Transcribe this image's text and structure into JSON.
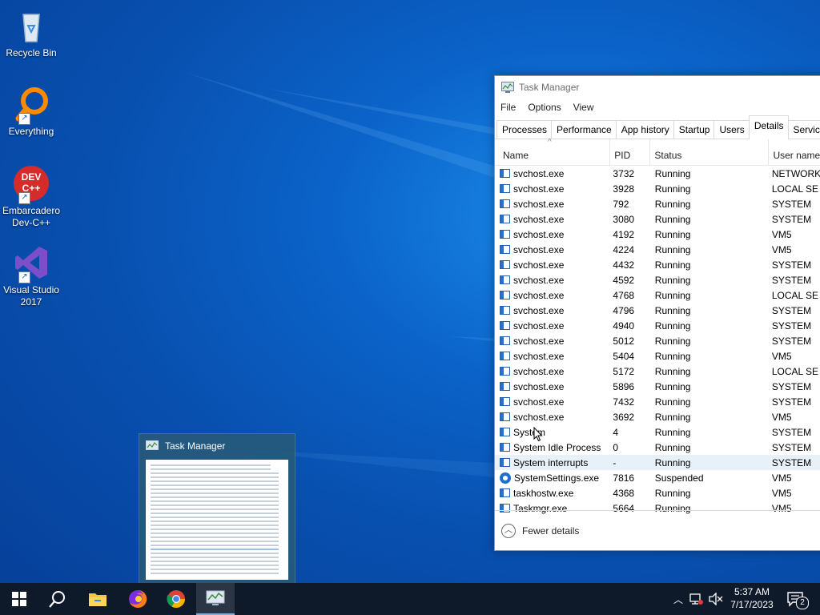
{
  "desktop": {
    "icons": [
      {
        "label": "Recycle Bin",
        "icon": "recycle-bin-icon"
      },
      {
        "label": "Everything",
        "icon": "everything-search-icon"
      },
      {
        "label": "Embarcadero Dev-C++",
        "icon": "dev-cpp-icon",
        "badge_text": "DEV C++"
      },
      {
        "label": "Visual Studio 2017",
        "icon": "visual-studio-icon"
      }
    ]
  },
  "task_manager": {
    "title": "Task Manager",
    "menu": [
      "File",
      "Options",
      "View"
    ],
    "tabs": [
      "Processes",
      "Performance",
      "App history",
      "Startup",
      "Users",
      "Details",
      "Services"
    ],
    "active_tab": "Details",
    "columns": [
      "Name",
      "PID",
      "Status",
      "User name"
    ],
    "rows": [
      {
        "name": "svchost.exe",
        "pid": "3732",
        "status": "Running",
        "user": "NETWORK"
      },
      {
        "name": "svchost.exe",
        "pid": "3928",
        "status": "Running",
        "user": "LOCAL SE"
      },
      {
        "name": "svchost.exe",
        "pid": "792",
        "status": "Running",
        "user": "SYSTEM"
      },
      {
        "name": "svchost.exe",
        "pid": "3080",
        "status": "Running",
        "user": "SYSTEM"
      },
      {
        "name": "svchost.exe",
        "pid": "4192",
        "status": "Running",
        "user": "VM5"
      },
      {
        "name": "svchost.exe",
        "pid": "4224",
        "status": "Running",
        "user": "VM5"
      },
      {
        "name": "svchost.exe",
        "pid": "4432",
        "status": "Running",
        "user": "SYSTEM"
      },
      {
        "name": "svchost.exe",
        "pid": "4592",
        "status": "Running",
        "user": "SYSTEM"
      },
      {
        "name": "svchost.exe",
        "pid": "4768",
        "status": "Running",
        "user": "LOCAL SE"
      },
      {
        "name": "svchost.exe",
        "pid": "4796",
        "status": "Running",
        "user": "SYSTEM"
      },
      {
        "name": "svchost.exe",
        "pid": "4940",
        "status": "Running",
        "user": "SYSTEM"
      },
      {
        "name": "svchost.exe",
        "pid": "5012",
        "status": "Running",
        "user": "SYSTEM"
      },
      {
        "name": "svchost.exe",
        "pid": "5404",
        "status": "Running",
        "user": "VM5"
      },
      {
        "name": "svchost.exe",
        "pid": "5172",
        "status": "Running",
        "user": "LOCAL SE"
      },
      {
        "name": "svchost.exe",
        "pid": "5896",
        "status": "Running",
        "user": "SYSTEM"
      },
      {
        "name": "svchost.exe",
        "pid": "7432",
        "status": "Running",
        "user": "SYSTEM"
      },
      {
        "name": "svchost.exe",
        "pid": "3692",
        "status": "Running",
        "user": "VM5"
      },
      {
        "name": "System",
        "pid": "4",
        "status": "Running",
        "user": "SYSTEM"
      },
      {
        "name": "System Idle Process",
        "pid": "0",
        "status": "Running",
        "user": "SYSTEM"
      },
      {
        "name": "System interrupts",
        "pid": "-",
        "status": "Running",
        "user": "SYSTEM"
      },
      {
        "name": "SystemSettings.exe",
        "pid": "7816",
        "status": "Suspended",
        "user": "VM5",
        "icon": "gear"
      },
      {
        "name": "taskhostw.exe",
        "pid": "4368",
        "status": "Running",
        "user": "VM5"
      },
      {
        "name": "Taskmgr.exe",
        "pid": "5664",
        "status": "Running",
        "user": "VM5"
      }
    ],
    "selected_row_index": 19,
    "footer_label": "Fewer details"
  },
  "taskbar_preview": {
    "title": "Task Manager"
  },
  "taskbar": {
    "pinned": [
      "start-button",
      "search-button",
      "file-explorer",
      "firefox",
      "chrome",
      "task-manager"
    ],
    "time": "5:37 AM",
    "date": "7/17/2023",
    "notification_count": "2"
  }
}
